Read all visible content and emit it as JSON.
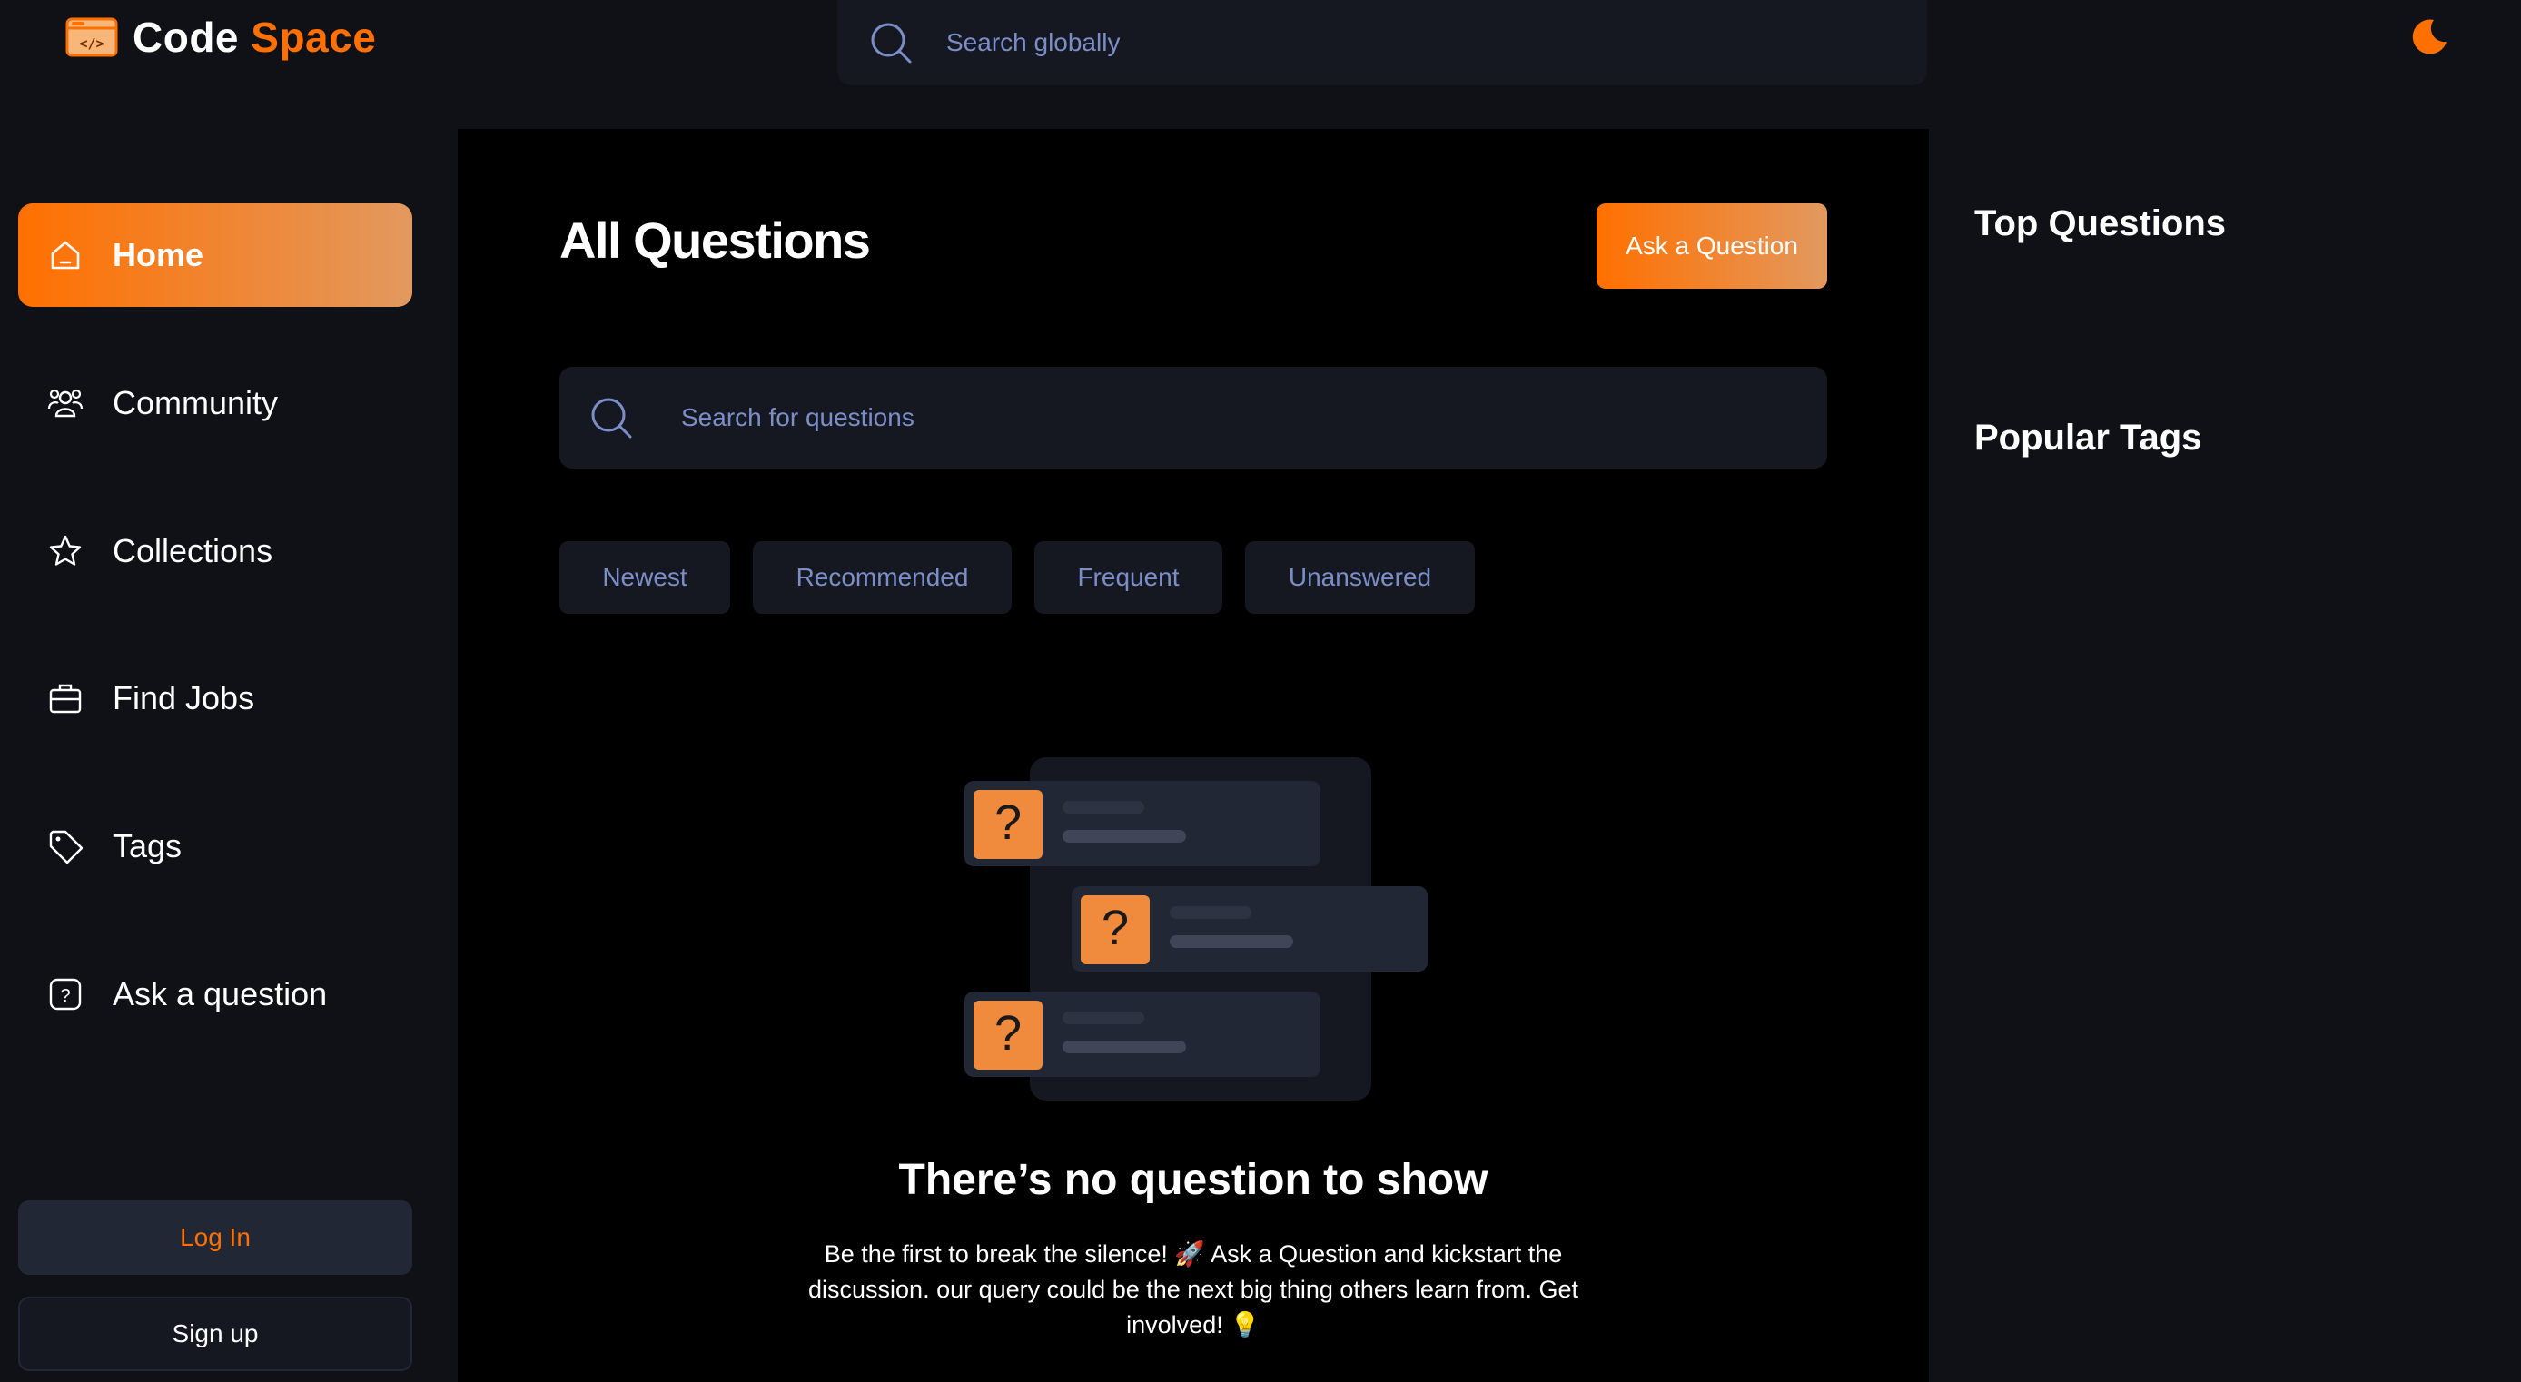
{
  "brand": {
    "name_part1": "Code",
    "name_part2": "Space",
    "accent_color": "#ff7000"
  },
  "global_search": {
    "placeholder": "Search globally",
    "icon": "search-icon"
  },
  "theme_toggle": {
    "icon": "moon-icon"
  },
  "sidebar": {
    "items": [
      {
        "label": "Home",
        "icon": "home-icon",
        "active": true
      },
      {
        "label": "Community",
        "icon": "users-icon",
        "active": false
      },
      {
        "label": "Collections",
        "icon": "star-icon",
        "active": false
      },
      {
        "label": "Find Jobs",
        "icon": "briefcase-icon",
        "active": false
      },
      {
        "label": "Tags",
        "icon": "tag-icon",
        "active": false
      },
      {
        "label": "Ask a question",
        "icon": "question-icon",
        "active": false
      }
    ],
    "login_label": "Log In",
    "signup_label": "Sign up"
  },
  "main": {
    "title": "All Questions",
    "ask_button_label": "Ask a Question",
    "search_placeholder": "Search for questions",
    "filters": [
      "Newest",
      "Recommended",
      "Frequent",
      "Unanswered"
    ],
    "empty_state": {
      "title": "There’s no question to show",
      "description": "Be the first to break the silence! 🚀 Ask a Question and kickstart the discussion. our query could be the next big thing others learn from. Get involved! 💡"
    }
  },
  "right_sidebar": {
    "top_questions_title": "Top Questions",
    "popular_tags_title": "Popular Tags"
  }
}
